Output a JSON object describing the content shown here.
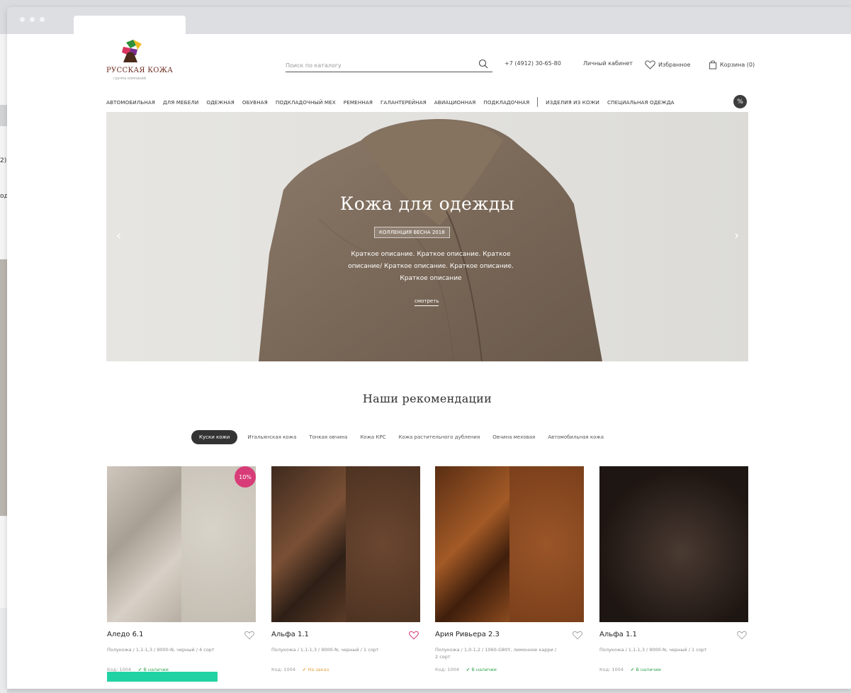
{
  "underlay": {
    "text1": "2)",
    "text2": "од"
  },
  "header": {
    "logo_title": "РУССКАЯ КОЖА",
    "logo_subtitle": "группа компаний",
    "search_placeholder": "Поиск по каталогу",
    "phone": "+7 (4912) 30-65-80",
    "account": "Личный кабинет",
    "favorites": "Избранное",
    "cart": "Корзина (0)"
  },
  "nav": {
    "items": [
      "Автомобильная",
      "Для мебели",
      "Одежная",
      "Обувная",
      "Подкладочный мех",
      "Ременная",
      "Галантерейная",
      "Авиационная",
      "Подкладочная"
    ],
    "items_right": [
      "Изделия из кожи",
      "Специальная одежда"
    ],
    "sale_icon": "%"
  },
  "hero": {
    "title": "Кожа для одежды",
    "badge": "КОЛЛЕНЦИЯ ВЕСНА 2018",
    "description": "Краткое описание. Краткое описание. Краткое описание/ Краткое описание. Краткое описание. Краткое описание",
    "link": "смотреть",
    "prev_arrow": "‹",
    "next_arrow": "›"
  },
  "recommendations": {
    "title": "Наши рекомендации",
    "tabs": [
      "Куски кожи",
      "Итальянская кожа",
      "Тонкая овчина",
      "Кожа КРС",
      "Кожа растительного дубления",
      "Овчина меховая",
      "Автомобильная кожа"
    ],
    "active_tab": "Куски кожи"
  },
  "products": [
    {
      "name": "Аледо 6.1",
      "desc": "Полукожа / 1,1-1,3 / 9000-N, черный / 4 сорт",
      "code": "Код: 1004",
      "status": "В наличии",
      "status_type": "in_stock",
      "discount": "10%",
      "favorite": false
    },
    {
      "name": "Альфа 1.1",
      "desc": "Полукожа / 1,1-1,3 / 9000-N, черный / 1 сорт",
      "code": "Код: 1004",
      "status": "На заказ",
      "status_type": "order",
      "favorite": true
    },
    {
      "name": "Ария Ривьера 2.3",
      "desc": "Полукожа / 1,0-1,2 / 1060-G80Y, лимонное карри / 2 сорт",
      "code": "Код: 1004",
      "status": "В наличии",
      "status_type": "in_stock",
      "favorite": false
    },
    {
      "name": "Альфа 1.1",
      "desc": "Полукожа / 1,1-1,3 / 9000-N, черный / 1 сорт",
      "code": "Код: 1004",
      "status": "В наличии",
      "status_type": "in_stock",
      "favorite": false
    }
  ],
  "colors": {
    "accent_pink": "#d83c78",
    "accent_green": "#21d3a4",
    "dark": "#333333"
  }
}
